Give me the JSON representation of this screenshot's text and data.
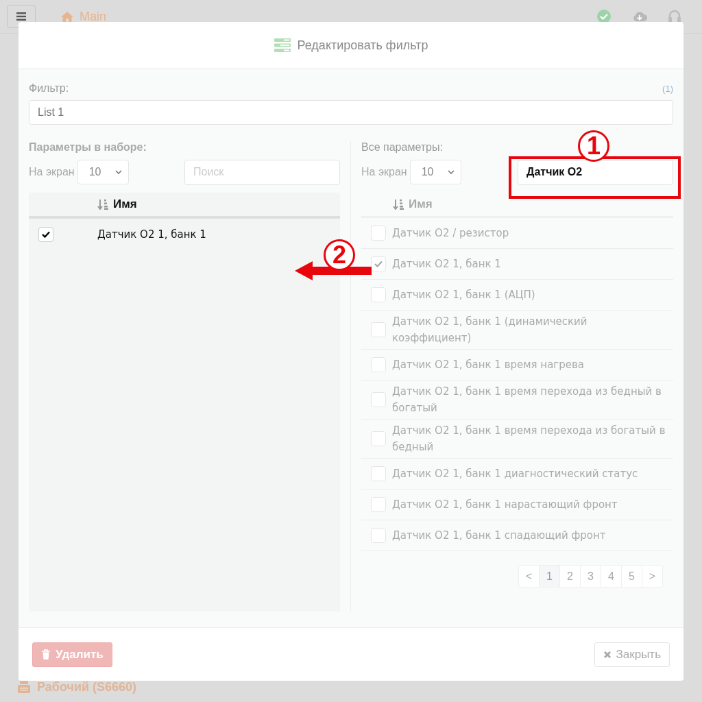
{
  "background": {
    "title": "Main",
    "footer_item": "Рабочий (S6660)"
  },
  "dialog": {
    "title": "Редактировать фильтр",
    "filter": {
      "label": "Фильтр:",
      "count": "(1)",
      "value": "List 1"
    },
    "selected_panel": {
      "title": "Параметры в наборе:",
      "per_page_label": "На экран",
      "per_page": "10",
      "search": {
        "placeholder": "Поиск"
      },
      "column": "Имя",
      "disabled": false,
      "rows": [
        {
          "name": "Датчик O2 1, банк 1",
          "checked": true
        }
      ]
    },
    "all_panel": {
      "title": "Все параметры:",
      "per_page_label": "На экран",
      "per_page": "10",
      "search": {
        "value": "Датчик O2"
      },
      "column": "Имя",
      "disabled": true,
      "rows": [
        {
          "name": "Датчик O2 / резистор",
          "checked": false
        },
        {
          "name": "Датчик O2 1, банк 1",
          "checked": true
        },
        {
          "name": "Датчик O2 1, банк 1 (АЦП)",
          "checked": false
        },
        {
          "name": "Датчик O2 1, банк 1 (динамический коэффициент)",
          "checked": false
        },
        {
          "name": "Датчик O2 1, банк 1 время нагрева",
          "checked": false
        },
        {
          "name": "Датчик O2 1, банк 1 время перехода из бедный в богатый",
          "checked": false
        },
        {
          "name": "Датчик O2 1, банк 1 время перехода из богатый в бедный",
          "checked": false
        },
        {
          "name": "Датчик O2 1, банк 1 диагностический статус",
          "checked": false
        },
        {
          "name": "Датчик O2 1, банк 1 нарастающий фронт",
          "checked": false
        },
        {
          "name": "Датчик O2 1, банк 1 спадающий фронт",
          "checked": false
        }
      ],
      "pagination": [
        {
          "label": "<",
          "selected": false
        },
        {
          "label": "1",
          "selected": true
        },
        {
          "label": "2",
          "selected": false
        },
        {
          "label": "3",
          "selected": false
        },
        {
          "label": "4",
          "selected": false
        },
        {
          "label": "5",
          "selected": false
        },
        {
          "label": ">",
          "selected": false
        }
      ]
    },
    "buttons": [
      {
        "label": "Удалить",
        "kind": "danger"
      },
      {
        "label": "Закрыть",
        "kind": "close"
      }
    ]
  },
  "annotations": [
    {
      "label": "1",
      "kind": "highlight"
    },
    {
      "label": "2",
      "kind": "arrow"
    }
  ]
}
